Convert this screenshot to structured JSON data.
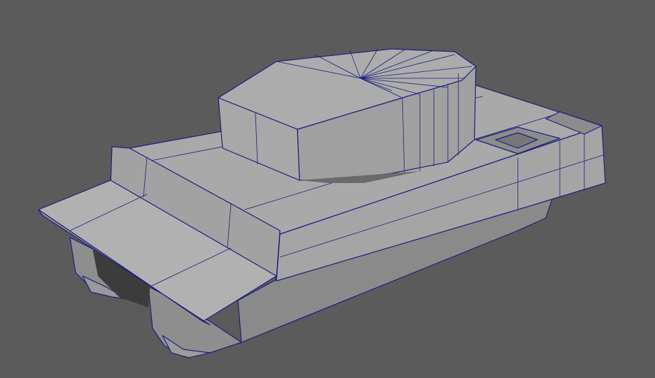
{
  "viewport": {
    "background_color": "#5b5b5b",
    "wireframe_color": "#1d1d80",
    "model": "tank-mesh"
  }
}
